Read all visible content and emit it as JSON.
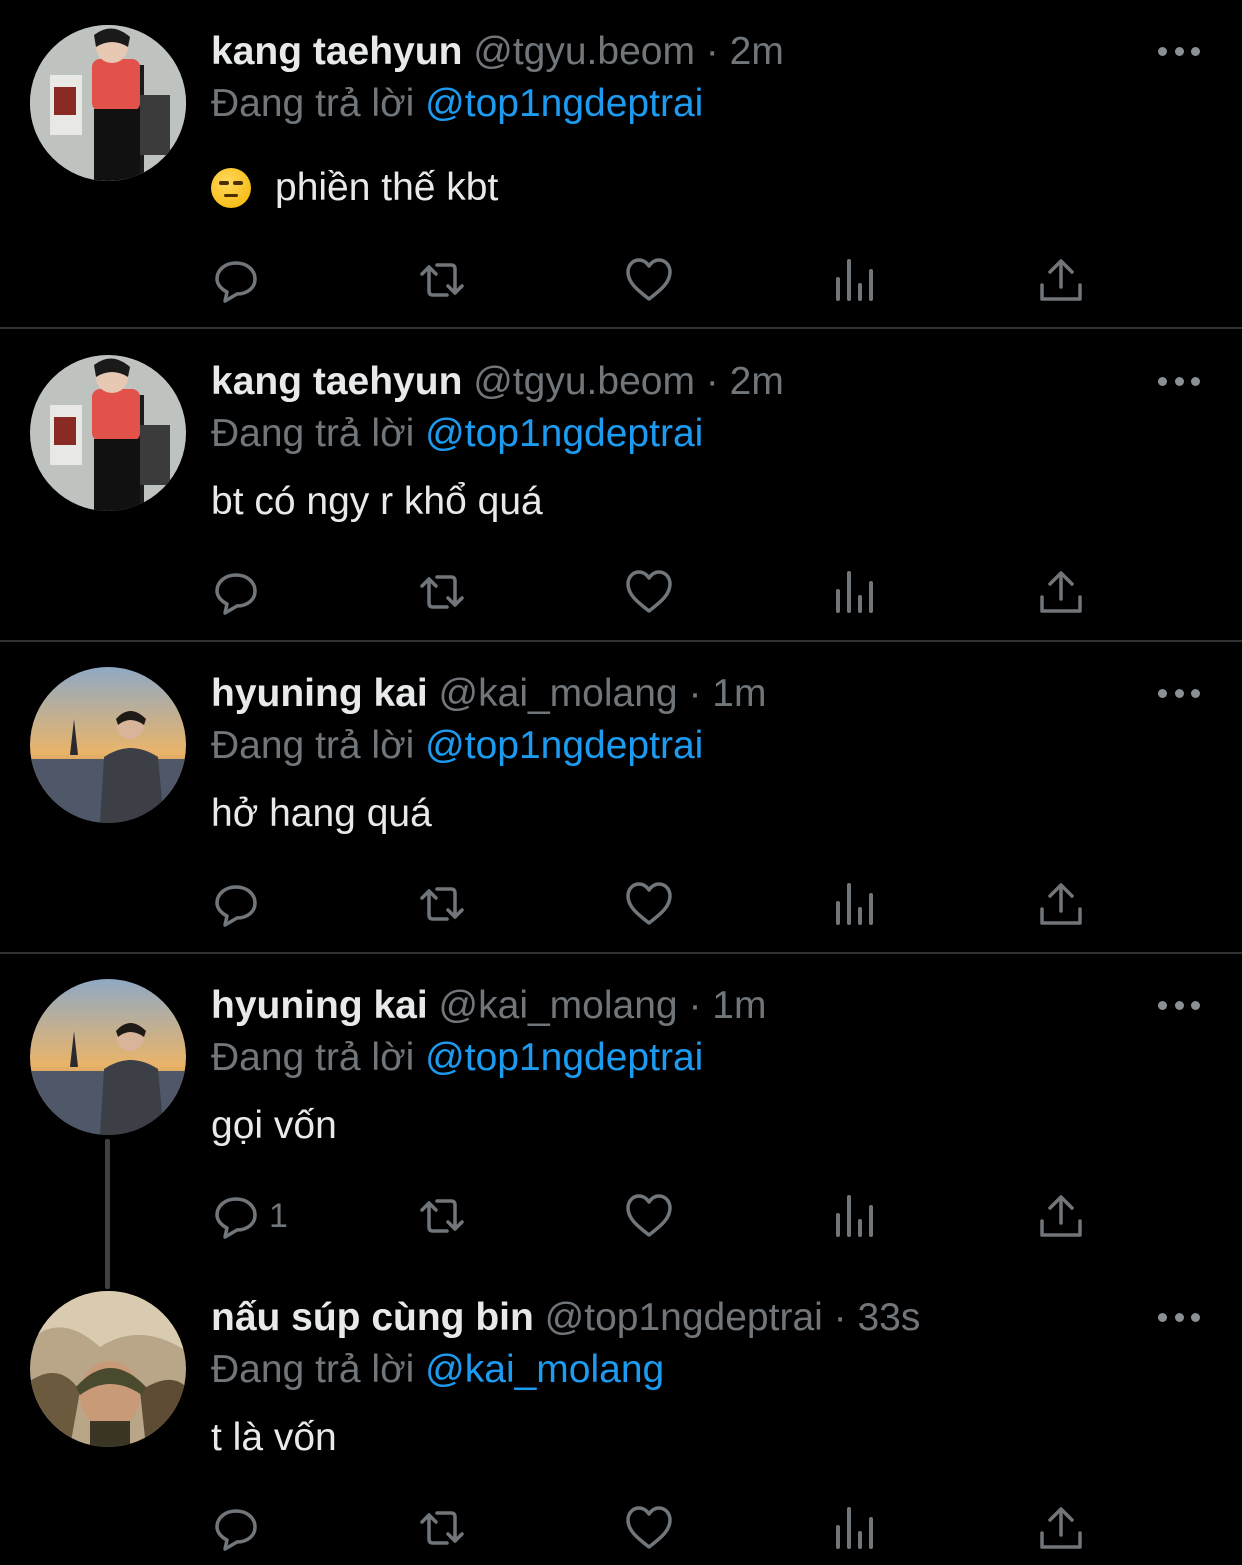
{
  "tweets": [
    {
      "name": "kang taehyun",
      "handle": "@tgyu.beom",
      "separator": "·",
      "time": "2m",
      "reply_prefix": "Đang trả lời",
      "reply_to": "@top1ngdeptrai",
      "text": "phiền thế kbt",
      "emoji": "unamused-face-emoji",
      "reply_count": ""
    },
    {
      "name": "kang taehyun",
      "handle": "@tgyu.beom",
      "separator": "·",
      "time": "2m",
      "reply_prefix": "Đang trả lời",
      "reply_to": "@top1ngdeptrai",
      "text": "bt có ngy r khổ quá",
      "reply_count": ""
    },
    {
      "name": "hyuning kai",
      "handle": "@kai_molang",
      "separator": "·",
      "time": "1m",
      "reply_prefix": "Đang trả lời",
      "reply_to": "@top1ngdeptrai",
      "text": "hở hang quá",
      "reply_count": ""
    },
    {
      "name": "hyuning kai",
      "handle": "@kai_molang",
      "separator": "·",
      "time": "1m",
      "reply_prefix": "Đang trả lời",
      "reply_to": "@top1ngdeptrai",
      "text": "gọi vốn",
      "reply_count": "1"
    },
    {
      "name": "nấu súp cùng bin",
      "handle": "@top1ngdeptrai",
      "separator": "·",
      "time": "33s",
      "reply_prefix": "Đang trả lời",
      "reply_to": "@kai_molang",
      "text": "t là vốn",
      "reply_count": ""
    }
  ],
  "icons": {
    "reply": "reply-icon",
    "retweet": "retweet-icon",
    "like": "like-icon",
    "views": "views-icon",
    "share": "share-icon",
    "more": "more-icon"
  },
  "colors": {
    "background": "#000000",
    "text": "#e7e9ea",
    "secondary": "#71767b",
    "mention": "#1d9bf0",
    "divider": "#2f3336"
  }
}
